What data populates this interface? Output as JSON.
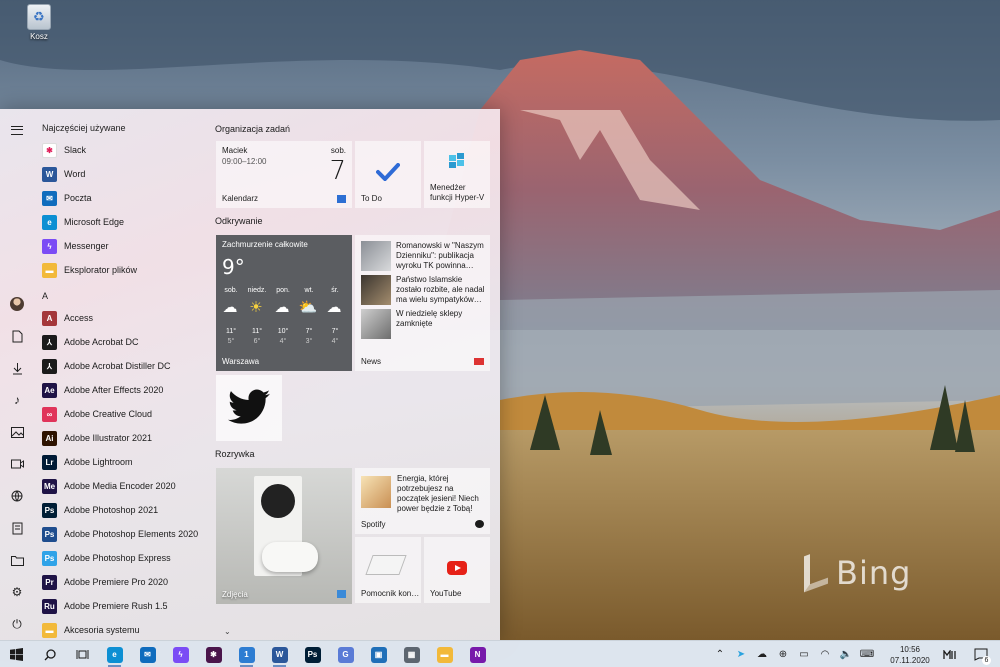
{
  "desktop": {
    "recycle_bin_label": "Kosz",
    "watermark": "Bing"
  },
  "start": {
    "recent_header": "Najczęściej używane",
    "recent": [
      {
        "label": "Slack",
        "icon": "slack-icon",
        "color": "#ffffff",
        "glyph": "✱"
      },
      {
        "label": "Word",
        "icon": "word-icon",
        "color": "#2b579a",
        "glyph": "W"
      },
      {
        "label": "Poczta",
        "icon": "mail-icon",
        "color": "#0f6cbd",
        "glyph": "✉"
      },
      {
        "label": "Microsoft Edge",
        "icon": "edge-icon",
        "color": "#0c8fd3",
        "glyph": "e"
      },
      {
        "label": "Messenger",
        "icon": "messenger-icon",
        "color": "#7b4cf5",
        "glyph": "ϟ"
      },
      {
        "label": "Eksplorator plików",
        "icon": "folder-icon",
        "color": "#f2b93a",
        "glyph": "▬"
      }
    ],
    "letter": "A",
    "apps": [
      {
        "label": "Access",
        "icon": "access-icon",
        "color": "#a4373a",
        "glyph": "A"
      },
      {
        "label": "Adobe Acrobat DC",
        "icon": "acrobat-icon",
        "color": "#1b1b1b",
        "glyph": "⅄"
      },
      {
        "label": "Adobe Acrobat Distiller DC",
        "icon": "distiller-icon",
        "color": "#1b1b1b",
        "glyph": "⅄"
      },
      {
        "label": "Adobe After Effects 2020",
        "icon": "after-effects-icon",
        "color": "#1f1346",
        "glyph": "Ae"
      },
      {
        "label": "Adobe Creative Cloud",
        "icon": "creative-cloud-icon",
        "color": "#e0345a",
        "glyph": "∞"
      },
      {
        "label": "Adobe Illustrator 2021",
        "icon": "illustrator-icon",
        "color": "#2e1300",
        "glyph": "Ai"
      },
      {
        "label": "Adobe Lightroom",
        "icon": "lightroom-icon",
        "color": "#001a35",
        "glyph": "Lr"
      },
      {
        "label": "Adobe Media Encoder 2020",
        "icon": "media-encoder-icon",
        "color": "#1f1346",
        "glyph": "Me"
      },
      {
        "label": "Adobe Photoshop 2021",
        "icon": "photoshop-icon",
        "color": "#001e36",
        "glyph": "Ps"
      },
      {
        "label": "Adobe Photoshop Elements 2020",
        "icon": "photoshop-elements-icon",
        "color": "#1f4d8e",
        "glyph": "Ps"
      },
      {
        "label": "Adobe Photoshop Express",
        "icon": "photoshop-express-icon",
        "color": "#2fa3e8",
        "glyph": "Ps"
      },
      {
        "label": "Adobe Premiere Pro 2020",
        "icon": "premiere-pro-icon",
        "color": "#1f1346",
        "glyph": "Pr"
      },
      {
        "label": "Adobe Premiere Rush 1.5",
        "icon": "premiere-rush-icon",
        "color": "#1f1346",
        "glyph": "Ru"
      },
      {
        "label": "Akcesoria systemu",
        "icon": "folder-icon",
        "color": "#f2b93a",
        "glyph": "▬"
      }
    ],
    "groups": {
      "organize": "Organizacja zadań",
      "discover": "Odkrywanie",
      "entertainment": "Rozrywka"
    },
    "calendar": {
      "who": "Maciek",
      "time": "09:00–12:00",
      "day": "sob.",
      "date": "7",
      "name": "Kalendarz"
    },
    "todo": {
      "name": "To Do"
    },
    "hyperv": {
      "name": "Menedżer funkcji Hyper-V"
    },
    "weather": {
      "condition": "Zachmurzenie całkowite",
      "temp": "9°",
      "location": "Warszawa",
      "days": [
        {
          "day": "sob.",
          "icon": "☁",
          "hi": "11°",
          "lo": "5°"
        },
        {
          "day": "niedz.",
          "icon": "☀",
          "hi": "11°",
          "lo": "6°"
        },
        {
          "day": "pon.",
          "icon": "☁",
          "hi": "10°",
          "lo": "4°"
        },
        {
          "day": "wt.",
          "icon": "⛅",
          "hi": "7°",
          "lo": "3°"
        },
        {
          "day": "śr.",
          "icon": "☁",
          "hi": "7°",
          "lo": "4°"
        }
      ]
    },
    "news": {
      "name": "News",
      "items": [
        "Romanowski w \"Naszym Dzienniku\": publikacja wyroku TK powinna…",
        "Państwo Islamskie zostało rozbite, ale nadal ma wielu sympatyków…",
        "W niedzielę sklepy zamknięte"
      ]
    },
    "twitter": {
      "name": "Twitter"
    },
    "photos": {
      "name": "Zdjęcia"
    },
    "spotify": {
      "name": "Spotify",
      "text": "Energia, której potrzebujesz na początek jesieni! Niech power będzie z Tobą!"
    },
    "pomocnik": {
      "name": "Pomocnik kon…"
    },
    "youtube": {
      "name": "YouTube"
    }
  },
  "taskbar": {
    "apps": [
      {
        "name": "edge",
        "icon": "edge-icon",
        "color": "#0c8fd3",
        "glyph": "e",
        "running": true
      },
      {
        "name": "mail",
        "icon": "mail-icon",
        "color": "#0f6cbd",
        "glyph": "✉",
        "running": false
      },
      {
        "name": "messenger",
        "icon": "messenger-icon",
        "color": "#7b4cf5",
        "glyph": "ϟ",
        "running": false
      },
      {
        "name": "slack",
        "icon": "slack-icon",
        "color": "#4a154b",
        "glyph": "✱",
        "running": false
      },
      {
        "name": "files",
        "icon": "folder-icon",
        "color": "#2d7dd2",
        "glyph": "1",
        "running": true
      },
      {
        "name": "word",
        "icon": "word-icon",
        "color": "#2b579a",
        "glyph": "W",
        "running": true
      },
      {
        "name": "photoshop",
        "icon": "photoshop-icon",
        "color": "#001e36",
        "glyph": "Ps",
        "running": false
      },
      {
        "name": "translator",
        "icon": "translator-icon",
        "color": "#5a7bd6",
        "glyph": "G",
        "running": false
      },
      {
        "name": "store",
        "icon": "store-icon",
        "color": "#1f6fb8",
        "glyph": "▣",
        "running": false
      },
      {
        "name": "calculator",
        "icon": "calculator-icon",
        "color": "#5d6670",
        "glyph": "▦",
        "running": false
      },
      {
        "name": "explorer",
        "icon": "folder-icon",
        "color": "#f2b93a",
        "glyph": "▬",
        "running": false
      },
      {
        "name": "onenote",
        "icon": "onenote-icon",
        "color": "#7719aa",
        "glyph": "N",
        "running": false
      }
    ],
    "tray_icons": [
      "chevron-up-icon",
      "telegram-icon",
      "cloud-icon",
      "network-icon",
      "battery-icon",
      "wifi-icon",
      "volume-icon",
      "keyboard-icon"
    ],
    "time": "10:56",
    "date": "07.11.2020",
    "notification_count": "6"
  }
}
